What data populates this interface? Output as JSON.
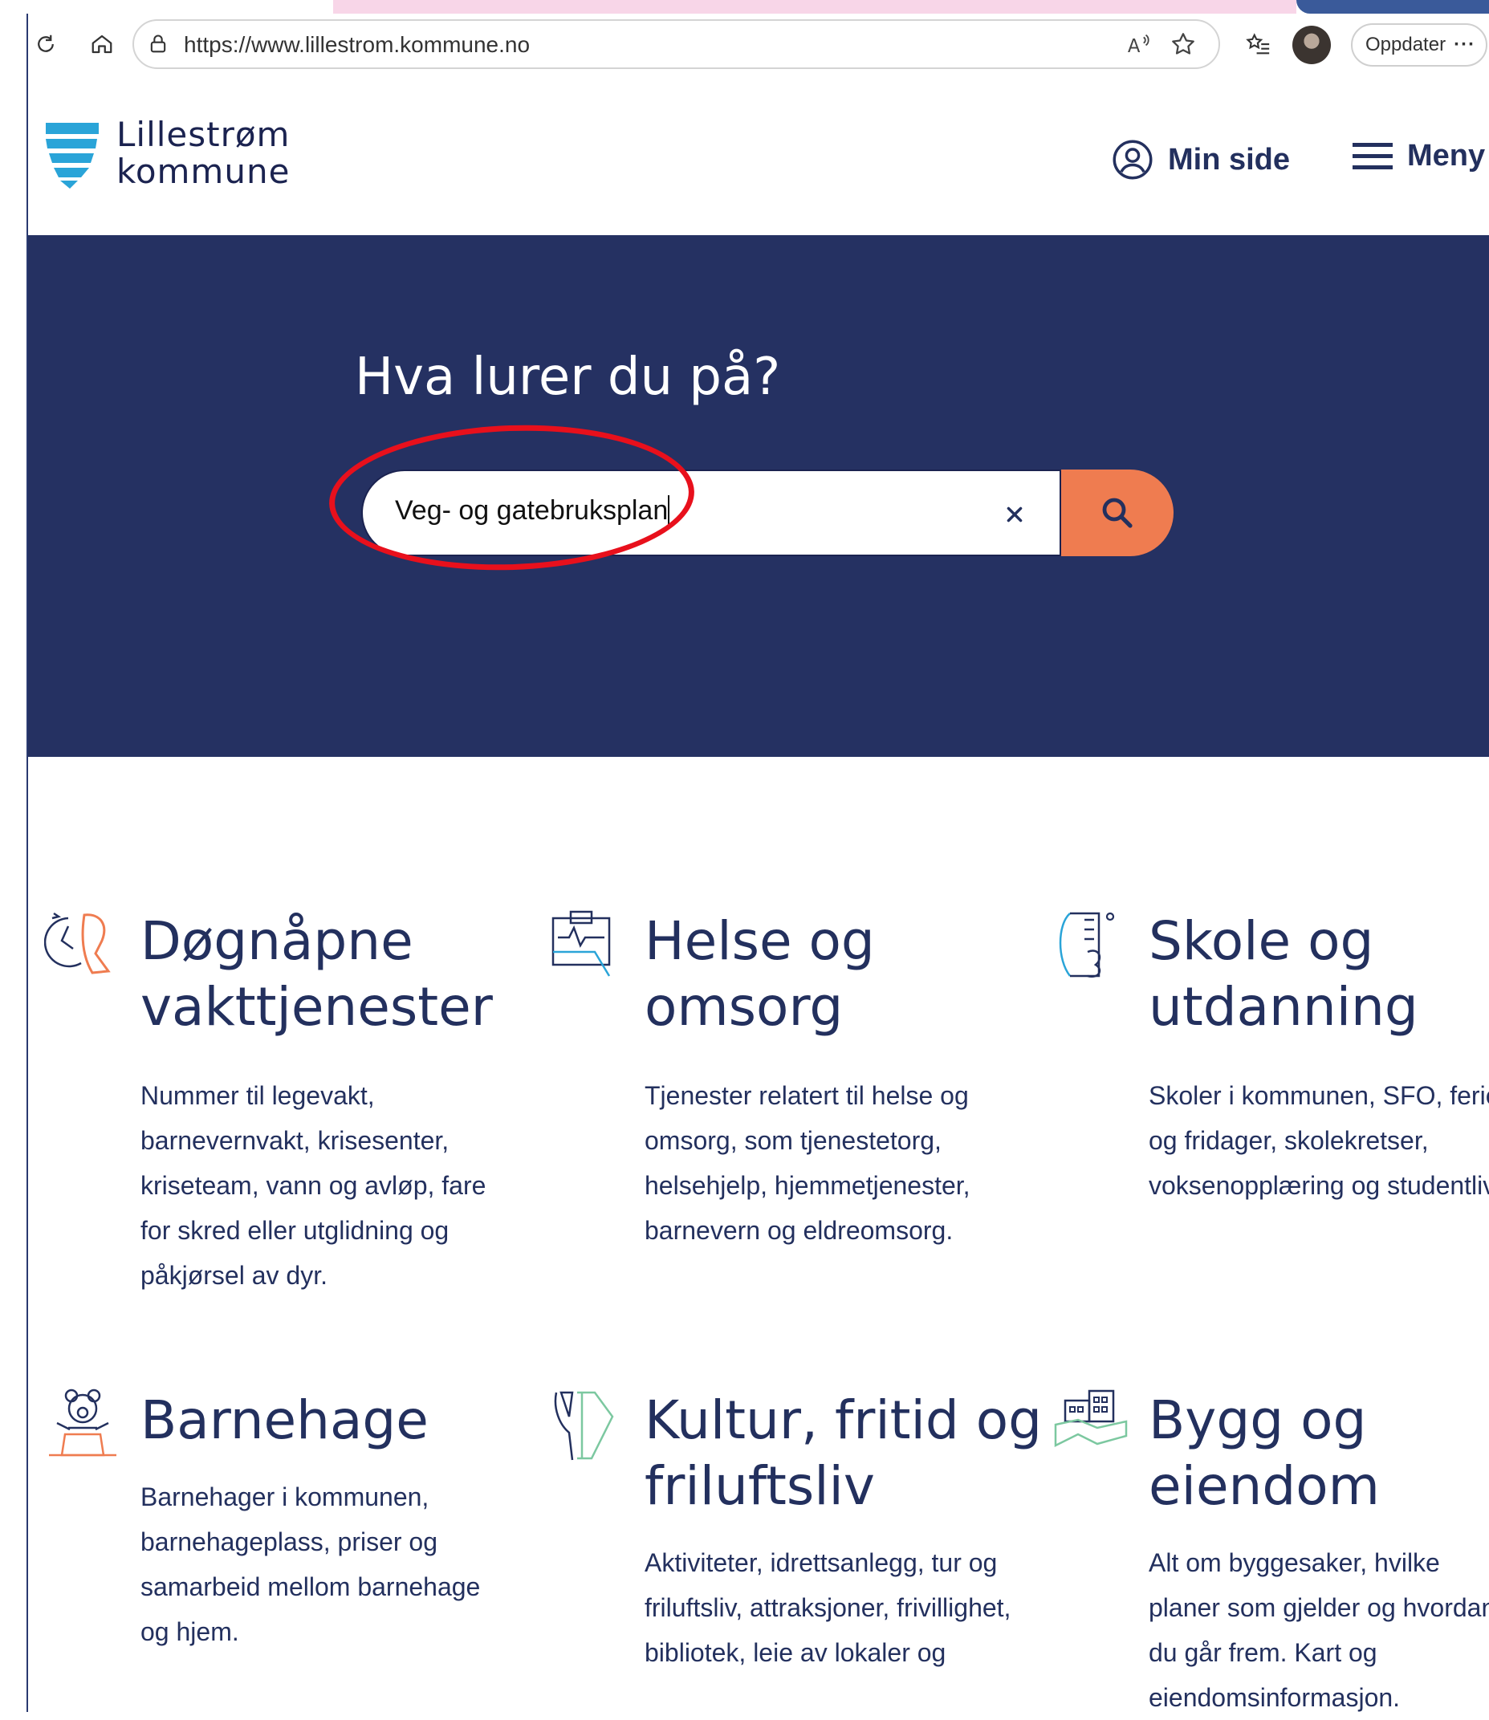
{
  "browser": {
    "url": "https://www.lillestrom.kommune.no",
    "update_label": "Oppdater"
  },
  "header": {
    "logo_line1": "Lillestrøm",
    "logo_line2": "kommune",
    "min_side": "Min side",
    "menu": "Meny"
  },
  "hero": {
    "title": "Hva lurer du på?",
    "search_value": "Veg- og gatebruksplan"
  },
  "colors": {
    "navy": "#253162",
    "accent": "#ef7c50",
    "annotation": "#e8101c"
  },
  "categories": [
    {
      "title": "Døgnåpne vakttjenester",
      "icon": "clock-person-icon",
      "desc": "Nummer til legevakt, barnevernvakt, krisesenter, kriseteam, vann og avløp, fare for skred eller utglidning og påkjørsel av dyr."
    },
    {
      "title": "Helse og omsorg",
      "icon": "health-clipboard-icon",
      "desc": "Tjenester relatert til helse og omsorg, som tjenestetorg, helsehjelp, hjemmetjenester, barnevern og eldreomsorg."
    },
    {
      "title": "Skole og utdanning",
      "icon": "school-book-icon",
      "desc": "Skoler i kommunen, SFO, ferie og fridager, skolekretser, voksenopplæring og studentliv."
    },
    {
      "title": "Barnehage",
      "icon": "teddy-bear-icon",
      "desc": "Barnehager i kommunen, barnehageplass, priser og samarbeid mellom barnehage og hjem."
    },
    {
      "title": "Kultur, fritid og friluftsliv",
      "icon": "culture-flag-icon",
      "desc": "Aktiviteter, idrettsanlegg, tur og friluftsliv, attraksjoner, frivillighet, bibliotek, leie av lokaler og"
    },
    {
      "title": "Bygg og eiendom",
      "icon": "buildings-map-icon",
      "desc": "Alt om byggesaker, hvilke planer som gjelder og hvordan du går frem. Kart og eiendomsinformasjon."
    }
  ]
}
